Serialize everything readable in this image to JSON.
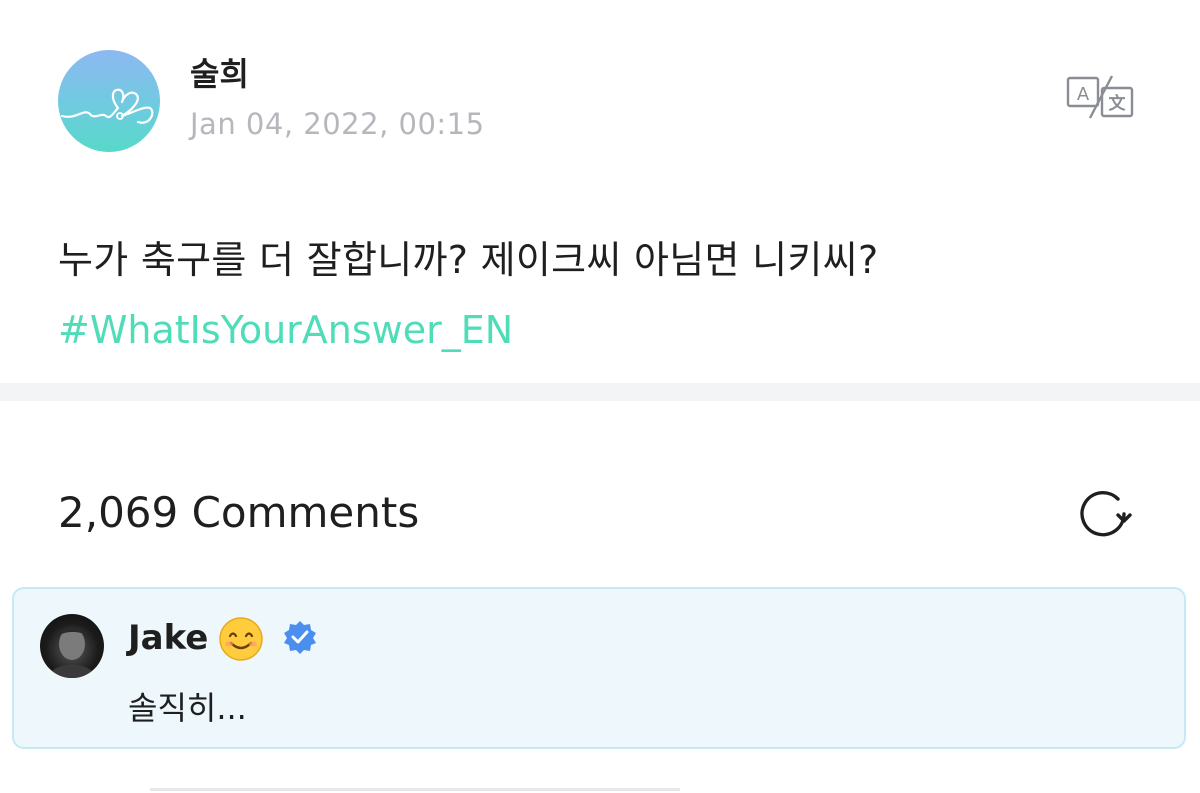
{
  "post": {
    "author": "술희",
    "date": "Jan 04, 2022, 00:15",
    "text": "누가 축구를 더 잘합니까? 제이크씨 아님면 니키씨?",
    "hashtag": "#WhatIsYourAnswer_EN",
    "translate_icon": "translate-icon"
  },
  "comments": {
    "count_label": "2,069 Comments",
    "refresh_icon": "refresh-icon",
    "items": [
      {
        "author": "Jake",
        "emoji": "smiling-face-emoji",
        "verified": true,
        "text": "솔직히..."
      }
    ]
  },
  "colors": {
    "hashtag": "#4fdcb8",
    "date": "#b5b7bc",
    "verified": "#4a8ff0",
    "comment_bg": "#eef8fc",
    "comment_border": "#c6e9f6"
  }
}
